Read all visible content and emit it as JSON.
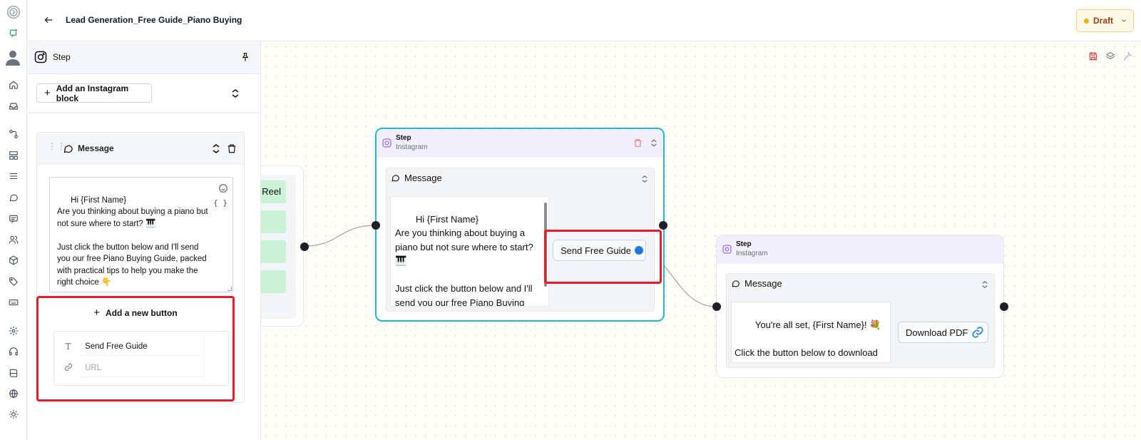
{
  "header": {
    "title": "Lead Generation_Free Guide_Piano Buying",
    "status": "Draft"
  },
  "panel": {
    "title": "Step",
    "add_block_label": "Add an Instagram block",
    "message_block": {
      "title": "Message",
      "text": "Hi {First Name}\nAre you thinking about buying a piano but not sure where to start? 🎹\n\nJust click the button below and I'll send you our free Piano Buying Guide, packed with practical tips to help you make the right choice 👇",
      "variables_label": "{ }"
    },
    "add_button_label": "Add a new button",
    "button_text_value": "Send Free Guide",
    "button_url_placeholder": "URL"
  },
  "canvas": {
    "partial_node": {
      "reel_label": "Reel"
    },
    "node_main": {
      "step_label": "Step",
      "channel": "Instagram",
      "message_title": "Message",
      "text": "Hi {First Name}\nAre you thinking about buying a piano but not sure where to start?\n🎹\n\nJust click the button below and I'll send you our free Piano Buying Guide, packed with practical tips to",
      "button_label": "Send Free Guide"
    },
    "node_second": {
      "step_label": "Step",
      "channel": "Instagram",
      "message_title": "Message",
      "text": "You're all set, {First Name}! 💐\n\nClick the button below to download your free Piano Buying Guide (PDF).",
      "button_label": "Download PDF"
    }
  },
  "colors": {
    "highlight": "#e11d2e",
    "selected_node_border": "#22b8d4",
    "draft_bg": "#fef8e6",
    "port_active": "#1f7ae0"
  }
}
